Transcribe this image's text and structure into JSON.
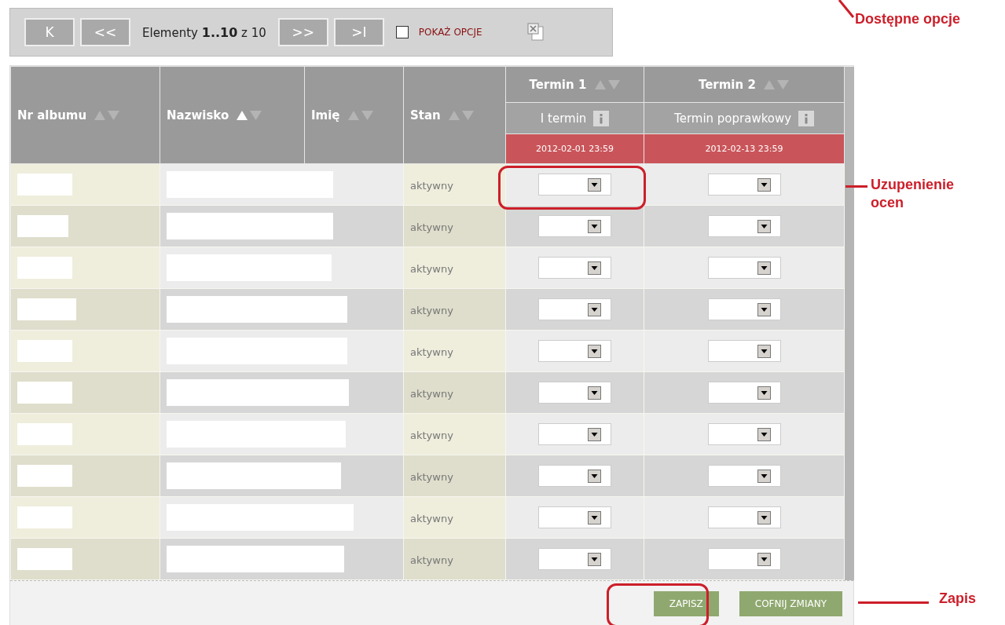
{
  "toolbar": {
    "nav_before": [
      "K",
      "<<"
    ],
    "nav_after": [
      ">>",
      ">I"
    ],
    "range_text": "Elementy **1..10** z 10",
    "show_options": {
      "label": "POKAŻ OPCJE",
      "checked": false
    }
  },
  "table": {
    "columns": [
      {
        "label": "Nr albumu",
        "sorted_asc": false
      },
      {
        "label": "Nazwisko",
        "sorted_asc": true
      },
      {
        "label": "Imię",
        "sorted_asc": false
      },
      {
        "label": "Stan",
        "sorted_asc": false
      }
    ],
    "terms": [
      {
        "label": "Termin 1",
        "sorted_asc": false,
        "subtitle": "I termin",
        "deadline": "2012-02-01 23:59"
      },
      {
        "label": "Termin 2",
        "sorted_asc": false,
        "subtitle": "Termin poprawkowy",
        "deadline": "2012-02-13 23:59"
      }
    ],
    "rows": [
      {
        "status": "aktywny"
      },
      {
        "status": "aktywny"
      },
      {
        "status": "aktywny"
      },
      {
        "status": "aktywny"
      },
      {
        "status": "aktywny"
      },
      {
        "status": "aktywny"
      },
      {
        "status": "aktywny"
      },
      {
        "status": "aktywny"
      },
      {
        "status": "aktywny"
      },
      {
        "status": "aktywny"
      }
    ]
  },
  "buttons": [
    "ZAPISZ",
    "COFNIJ ZMIANY"
  ],
  "annotations": [
    {
      "text": "Dostępne opcje"
    },
    {
      "text": "Uzupenienie ocen"
    },
    {
      "text": "Zapis"
    }
  ]
}
